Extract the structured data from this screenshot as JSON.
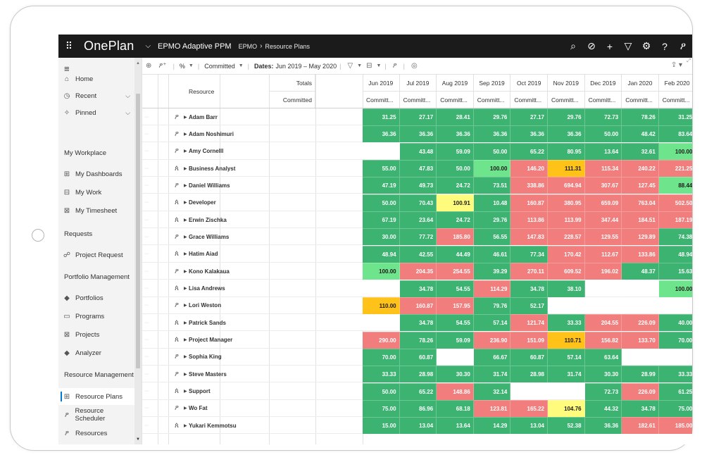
{
  "app": {
    "brand": "OnePlan",
    "project": "EPMO Adaptive PPM",
    "breadcrumb": [
      "EPMO",
      "Resource Plans"
    ]
  },
  "topbar_icons": [
    "search-icon",
    "target-icon",
    "add-icon",
    "filter-icon",
    "settings-icon",
    "help-icon",
    "user-icon"
  ],
  "sidebar": {
    "top": [
      {
        "label": "Home",
        "icon": "home-icon"
      },
      {
        "label": "Recent",
        "icon": "clock-icon",
        "caret": true
      },
      {
        "label": "Pinned",
        "icon": "pin-icon",
        "caret": true
      }
    ],
    "sections": [
      {
        "title": "My Workplace",
        "items": [
          {
            "label": "My Dashboards",
            "icon": "dashboard-icon"
          },
          {
            "label": "My Work",
            "icon": "work-icon"
          },
          {
            "label": "My Timesheet",
            "icon": "timesheet-icon"
          }
        ]
      },
      {
        "title": "Requests",
        "items": [
          {
            "label": "Project Request",
            "icon": "request-icon"
          }
        ]
      },
      {
        "title": "Portfolio Management",
        "items": [
          {
            "label": "Portfolios",
            "icon": "portfolio-icon"
          },
          {
            "label": "Programs",
            "icon": "programs-icon"
          },
          {
            "label": "Projects",
            "icon": "projects-icon"
          },
          {
            "label": "Analyzer",
            "icon": "analyzer-icon"
          }
        ]
      },
      {
        "title": "Resource Management",
        "items": [
          {
            "label": "Resource Plans",
            "icon": "resource-plans-icon",
            "active": true
          },
          {
            "label": "Resource Scheduler",
            "icon": "scheduler-icon"
          },
          {
            "label": "Resources",
            "icon": "resources-icon"
          }
        ]
      }
    ]
  },
  "cmdbar": {
    "percent": "%",
    "mode": "Committed",
    "dates_label": "Dates:",
    "dates_value": "Jun 2019 – May 2020"
  },
  "grid": {
    "resource_header": "Resource",
    "totals_header": "Totals",
    "totals_sub": "Committed",
    "months": [
      "Jun 2019",
      "Jul 2019",
      "Aug 2019",
      "Sep 2019",
      "Oct 2019",
      "Nov 2019",
      "Dec 2019",
      "Jan 2020",
      "Feb 2020"
    ],
    "sub_label": "Committ...",
    "colors": {
      "green": "#3cb371",
      "lightgreen": "#6ee48c",
      "red": "#f17d7d",
      "yellow": "#fffb7d",
      "orange": "#ffc219",
      "empty": "#ffffff"
    },
    "rows": [
      {
        "name": "Adam Barr",
        "type": "person",
        "values": [
          "31.25",
          "27.17",
          "28.41",
          "29.76",
          "27.17",
          "29.76",
          "72.73",
          "78.26",
          "31.25"
        ],
        "status": [
          "g",
          "g",
          "g",
          "g",
          "g",
          "g",
          "g",
          "g",
          "g"
        ]
      },
      {
        "name": "Adam Noshimuri",
        "type": "person",
        "values": [
          "36.36",
          "36.36",
          "36.36",
          "36.36",
          "36.36",
          "36.36",
          "50.00",
          "48.42",
          "83.64"
        ],
        "status": [
          "g",
          "g",
          "g",
          "g",
          "g",
          "g",
          "g",
          "g",
          "g"
        ]
      },
      {
        "name": "Amy Cornelll",
        "type": "person",
        "values": [
          "",
          "43.48",
          "59.09",
          "50.00",
          "65.22",
          "80.95",
          "13.64",
          "32.61",
          "100.00"
        ],
        "status": [
          "e",
          "g",
          "g",
          "g",
          "g",
          "g",
          "g",
          "g",
          "l"
        ]
      },
      {
        "name": "Business Analyst",
        "type": "role",
        "values": [
          "55.00",
          "47.83",
          "50.00",
          "100.00",
          "146.20",
          "111.31",
          "115.34",
          "240.22",
          "221.25"
        ],
        "status": [
          "g",
          "g",
          "g",
          "l",
          "r",
          "o",
          "r",
          "r",
          "r"
        ]
      },
      {
        "name": "Daniel Williams",
        "type": "person",
        "values": [
          "47.19",
          "49.73",
          "24.72",
          "73.51",
          "338.86",
          "694.94",
          "307.67",
          "127.45",
          "88.44"
        ],
        "status": [
          "g",
          "g",
          "g",
          "g",
          "r",
          "r",
          "r",
          "r",
          "l"
        ]
      },
      {
        "name": "Developer",
        "type": "role",
        "values": [
          "50.00",
          "70.43",
          "100.91",
          "10.48",
          "160.87",
          "380.95",
          "659.09",
          "763.04",
          "502.50"
        ],
        "status": [
          "g",
          "g",
          "y",
          "g",
          "r",
          "r",
          "r",
          "r",
          "r"
        ]
      },
      {
        "name": "Erwin Zischka",
        "type": "role",
        "values": [
          "67.19",
          "23.64",
          "24.72",
          "29.76",
          "113.86",
          "113.99",
          "347.44",
          "184.51",
          "187.19"
        ],
        "status": [
          "g",
          "g",
          "g",
          "g",
          "r",
          "r",
          "r",
          "r",
          "r"
        ]
      },
      {
        "name": "Grace Williams",
        "type": "person",
        "values": [
          "30.00",
          "77.72",
          "185.80",
          "56.55",
          "147.83",
          "228.57",
          "129.55",
          "129.89",
          "74.38"
        ],
        "status": [
          "g",
          "g",
          "r",
          "g",
          "r",
          "r",
          "r",
          "r",
          "g"
        ]
      },
      {
        "name": "Hatim Aiad",
        "type": "role",
        "values": [
          "48.94",
          "42.55",
          "44.49",
          "46.61",
          "77.34",
          "170.42",
          "112.67",
          "133.86",
          "48.94"
        ],
        "status": [
          "g",
          "g",
          "g",
          "g",
          "g",
          "r",
          "r",
          "r",
          "g"
        ]
      },
      {
        "name": "Kono Kalakaua",
        "type": "person",
        "values": [
          "100.00",
          "204.35",
          "254.55",
          "39.29",
          "270.11",
          "609.52",
          "196.02",
          "48.37",
          "15.63"
        ],
        "status": [
          "l",
          "r",
          "r",
          "g",
          "r",
          "r",
          "r",
          "g",
          "g"
        ]
      },
      {
        "name": "Lisa Andrews",
        "type": "role",
        "values": [
          "",
          "34.78",
          "54.55",
          "114.29",
          "34.78",
          "38.10",
          "",
          "",
          "100.00"
        ],
        "status": [
          "e",
          "g",
          "g",
          "r",
          "g",
          "g",
          "e",
          "e",
          "l"
        ]
      },
      {
        "name": "Lori Weston",
        "type": "person",
        "values": [
          "110.00",
          "160.87",
          "157.95",
          "79.76",
          "52.17",
          "",
          "",
          "",
          ""
        ],
        "status": [
          "o",
          "r",
          "r",
          "g",
          "g",
          "e",
          "e",
          "e",
          "e"
        ]
      },
      {
        "name": "Patrick Sands",
        "type": "role",
        "values": [
          "",
          "34.78",
          "54.55",
          "57.14",
          "121.74",
          "33.33",
          "204.55",
          "226.09",
          "40.00"
        ],
        "status": [
          "e",
          "g",
          "g",
          "g",
          "r",
          "g",
          "r",
          "r",
          "g"
        ]
      },
      {
        "name": "Project Manager",
        "type": "role",
        "values": [
          "290.00",
          "78.26",
          "59.09",
          "236.90",
          "151.09",
          "110.71",
          "156.82",
          "133.70",
          "70.00"
        ],
        "status": [
          "r",
          "g",
          "g",
          "r",
          "r",
          "o",
          "r",
          "r",
          "g"
        ]
      },
      {
        "name": "Sophia King",
        "type": "person",
        "values": [
          "70.00",
          "60.87",
          "",
          "66.67",
          "60.87",
          "57.14",
          "63.64",
          "",
          ""
        ],
        "status": [
          "g",
          "g",
          "e",
          "g",
          "g",
          "g",
          "g",
          "e",
          "e"
        ]
      },
      {
        "name": "Steve Masters",
        "type": "person",
        "values": [
          "33.33",
          "28.98",
          "30.30",
          "31.74",
          "28.98",
          "31.74",
          "30.30",
          "28.99",
          "33.33"
        ],
        "status": [
          "g",
          "g",
          "g",
          "g",
          "g",
          "g",
          "g",
          "g",
          "g"
        ]
      },
      {
        "name": "Support",
        "type": "role",
        "values": [
          "50.00",
          "65.22",
          "148.86",
          "32.14",
          "",
          "",
          "72.73",
          "226.09",
          "61.25"
        ],
        "status": [
          "g",
          "g",
          "r",
          "g",
          "e",
          "e",
          "g",
          "r",
          "g"
        ]
      },
      {
        "name": "Wo Fat",
        "type": "person",
        "values": [
          "75.00",
          "86.96",
          "68.18",
          "123.81",
          "165.22",
          "104.76",
          "44.32",
          "34.78",
          "75.00"
        ],
        "status": [
          "g",
          "g",
          "g",
          "r",
          "r",
          "y",
          "g",
          "g",
          "g"
        ]
      },
      {
        "name": "Yukari Kemmotsu",
        "type": "role",
        "values": [
          "15.00",
          "13.04",
          "13.64",
          "14.29",
          "13.04",
          "52.38",
          "36.36",
          "182.61",
          "185.00"
        ],
        "status": [
          "g",
          "g",
          "g",
          "g",
          "g",
          "g",
          "g",
          "r",
          "r"
        ]
      }
    ]
  }
}
